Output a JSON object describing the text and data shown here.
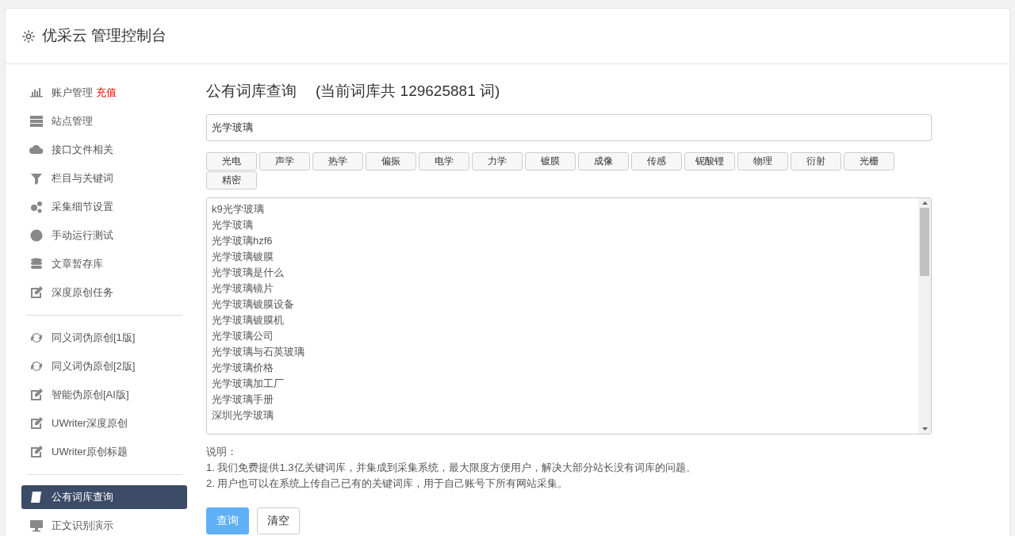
{
  "header": {
    "title": "优采云 管理控制台"
  },
  "sidebar": {
    "groups": [
      {
        "items": [
          {
            "label": "账户管理",
            "badge": "充值",
            "selected": false
          },
          {
            "label": "站点管理",
            "selected": false
          },
          {
            "label": "接口文件相关",
            "selected": false
          },
          {
            "label": "栏目与关键词",
            "selected": false
          },
          {
            "label": "采集细节设置",
            "selected": false
          },
          {
            "label": "手动运行测试",
            "selected": false
          },
          {
            "label": "文章暂存库",
            "selected": false
          },
          {
            "label": "深度原创任务",
            "selected": false
          }
        ]
      },
      {
        "items": [
          {
            "label": "同义词伪原创[1版]",
            "selected": false
          },
          {
            "label": "同义词伪原创[2版]",
            "selected": false
          },
          {
            "label": "智能伪原创[AI版]",
            "selected": false
          },
          {
            "label": "UWriter深度原创",
            "selected": false
          },
          {
            "label": "UWriter原创标题",
            "selected": false
          }
        ]
      },
      {
        "items": [
          {
            "label": "公有词库查询",
            "selected": true
          },
          {
            "label": "正文识别演示",
            "selected": false
          }
        ]
      }
    ]
  },
  "main": {
    "title": "公有词库查询",
    "count": "(当前词库共 129625881 词)",
    "search": {
      "value": "光学玻璃"
    },
    "tags": [
      "光电",
      "声学",
      "热学",
      "偏振",
      "电学",
      "力学",
      "镀膜",
      "成像",
      "传感",
      "铌酸锂",
      "物理",
      "衍射",
      "光栅",
      "精密"
    ],
    "results": [
      "k9光学玻璃",
      "光学玻璃",
      "光学玻璃hzf6",
      "光学玻璃镀膜",
      "光学玻璃是什么",
      "光学玻璃镜片",
      "光学玻璃镀膜设备",
      "光学玻璃镀膜机",
      "光学玻璃公司",
      "光学玻璃与石英玻璃",
      "光学玻璃价格",
      "光学玻璃加工厂",
      "光学玻璃手册",
      "深圳光学玻璃"
    ],
    "notes_title": "说明：",
    "notes": [
      "1. 我们免费提供1.3亿关键词库，并集成到采集系统，最大限度方便用户，解决大部分站长没有词库的问题。",
      "2. 用户也可以在系统上传自己已有的关键词库，用于自己账号下所有网站采集。"
    ],
    "buttons": [
      {
        "label": "查询",
        "kind": "primary"
      },
      {
        "label": "清空",
        "kind": "default"
      }
    ]
  }
}
